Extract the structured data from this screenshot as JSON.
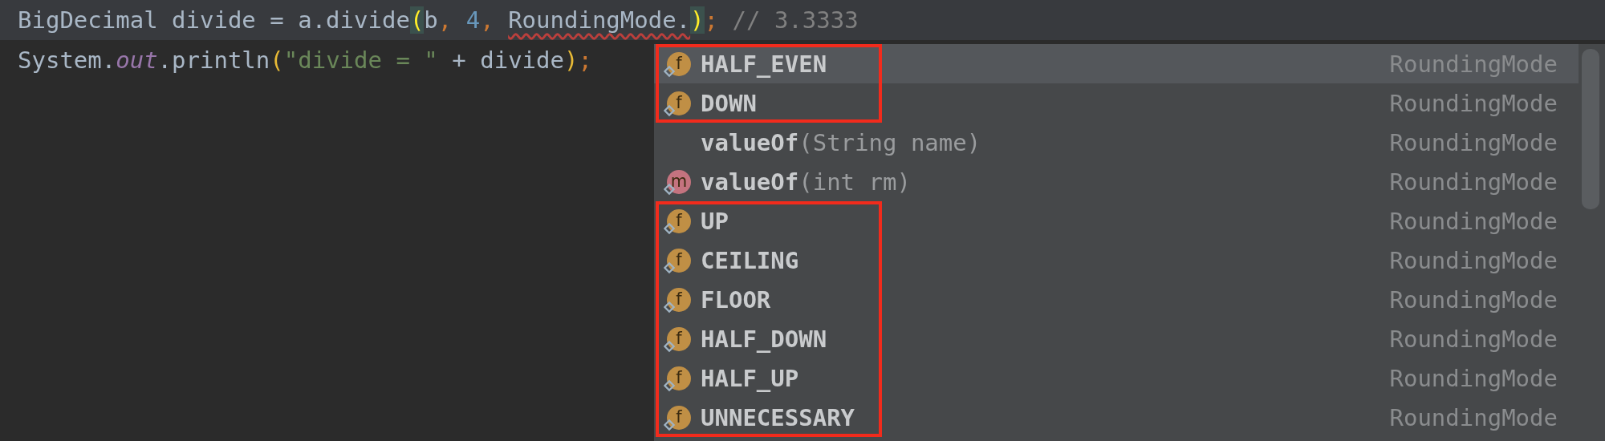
{
  "editor": {
    "lines": [
      {
        "current": true,
        "tokens": [
          {
            "kind": "plain",
            "text": "BigDecimal divide = a.divide"
          },
          {
            "kind": "brace",
            "text": "("
          },
          {
            "kind": "plain",
            "text": "b"
          },
          {
            "kind": "punct",
            "text": ", "
          },
          {
            "kind": "number",
            "text": "4"
          },
          {
            "kind": "punct",
            "text": ", "
          },
          {
            "kind": "error",
            "text": "RoundingMode."
          },
          {
            "kind": "brace",
            "text": ")"
          },
          {
            "kind": "punct",
            "text": "; "
          },
          {
            "kind": "comment",
            "text": "// 3.3333"
          }
        ]
      },
      {
        "current": false,
        "tokens": [
          {
            "kind": "plain",
            "text": "System."
          },
          {
            "kind": "static",
            "text": "out"
          },
          {
            "kind": "plain",
            "text": ".println"
          },
          {
            "kind": "paren",
            "text": "("
          },
          {
            "kind": "string",
            "text": "\"divide = \""
          },
          {
            "kind": "plain",
            "text": " + divide"
          },
          {
            "kind": "paren",
            "text": ")"
          },
          {
            "kind": "punct",
            "text": ";"
          }
        ]
      }
    ]
  },
  "completion_popup": {
    "groups": [
      {
        "boxed": true,
        "items": [
          {
            "kind": "field",
            "badge": "f",
            "name": "HALF_EVEN",
            "type": "RoundingMode",
            "selected": true
          },
          {
            "kind": "field",
            "badge": "f",
            "name": "DOWN",
            "type": "RoundingMode",
            "selected": false
          }
        ]
      },
      {
        "boxed": false,
        "items": [
          {
            "kind": "none",
            "name": "valueOf",
            "params": "(String name)",
            "type": "RoundingMode",
            "selected": false
          },
          {
            "kind": "method",
            "badge": "m",
            "name": "valueOf",
            "params": "(int rm)",
            "type": "RoundingMode",
            "selected": false
          }
        ]
      },
      {
        "boxed": true,
        "items": [
          {
            "kind": "field",
            "badge": "f",
            "name": "UP",
            "type": "RoundingMode",
            "selected": false
          },
          {
            "kind": "field",
            "badge": "f",
            "name": "CEILING",
            "type": "RoundingMode",
            "selected": false
          },
          {
            "kind": "field",
            "badge": "f",
            "name": "FLOOR",
            "type": "RoundingMode",
            "selected": false
          },
          {
            "kind": "field",
            "badge": "f",
            "name": "HALF_DOWN",
            "type": "RoundingMode",
            "selected": false
          },
          {
            "kind": "field",
            "badge": "f",
            "name": "HALF_UP",
            "type": "RoundingMode",
            "selected": false
          },
          {
            "kind": "field",
            "badge": "f",
            "name": "UNNECESSARY",
            "type": "RoundingMode",
            "selected": false
          }
        ]
      }
    ]
  }
}
